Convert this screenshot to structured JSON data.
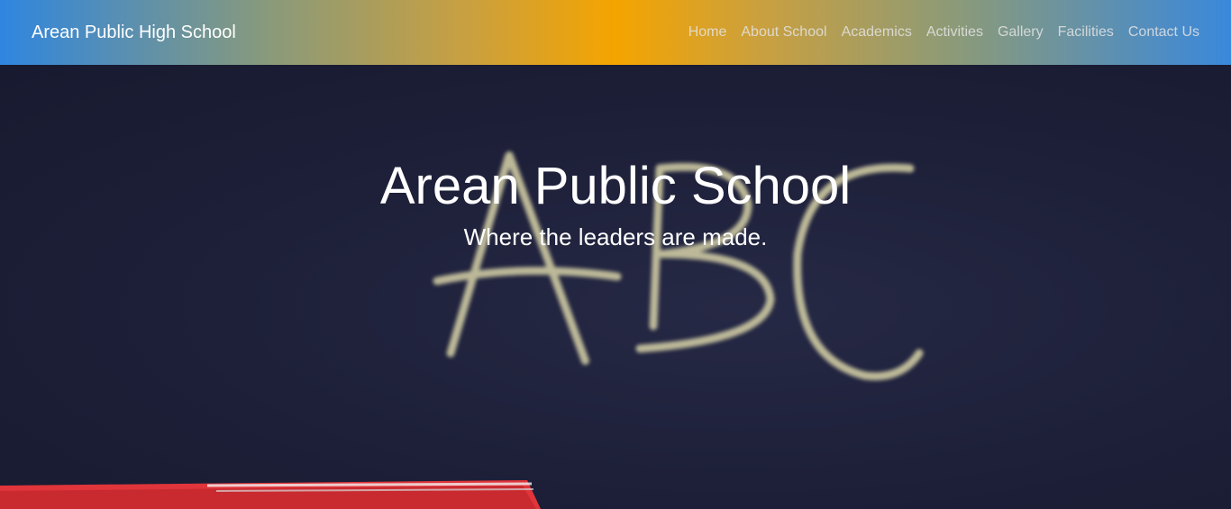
{
  "navbar": {
    "brand": "Arean Public High School",
    "links": [
      {
        "label": "Home"
      },
      {
        "label": "About School"
      },
      {
        "label": "Academics"
      },
      {
        "label": "Activities"
      },
      {
        "label": "Gallery"
      },
      {
        "label": "Facilities"
      },
      {
        "label": "Contact Us"
      }
    ]
  },
  "hero": {
    "title": "Arean Public School",
    "tagline": "Where the leaders are made.",
    "background": "chalkboard with ABC written in chalk, red book in lower-left corner"
  },
  "colors": {
    "nav_gradient_start": "#2f86e0",
    "nav_gradient_mid": "#f5a400",
    "nav_gradient_end": "#3a88dc",
    "chalkboard": "#1d1f38",
    "chalk": "#d8d3a8",
    "book_red": "#e0353a"
  }
}
